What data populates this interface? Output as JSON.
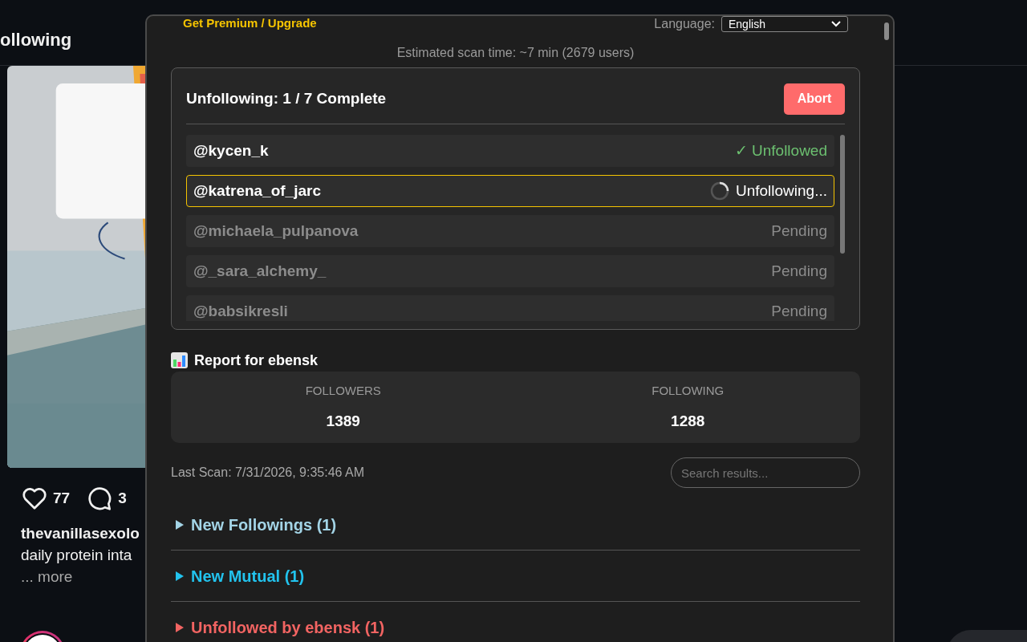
{
  "feed": {
    "header": "ollowing",
    "likes": "77",
    "comments": "3",
    "author": "thevanillasexolo",
    "caption": "daily protein inta",
    "more": "... more"
  },
  "panel": {
    "premium_link": "Get Premium / Upgrade",
    "language_label": "Language:",
    "language": "English",
    "estimate": "Estimated scan time: ~7 min (2679 users)",
    "progress": {
      "title": "Unfollowing: 1 / 7 Complete",
      "abort": "Abort",
      "rows": [
        {
          "user": "@kycen_k",
          "kind": "done",
          "label": "✓ Unfollowed"
        },
        {
          "user": "@katrena_of_jarc",
          "kind": "active",
          "label": "Unfollowing..."
        },
        {
          "user": "@michaela_pulpanova",
          "kind": "pending",
          "label": "Pending"
        },
        {
          "user": "@_sara_alchemy_",
          "kind": "pending",
          "label": "Pending"
        },
        {
          "user": "@babsikresli",
          "kind": "pending",
          "label": "Pending"
        }
      ]
    },
    "report": {
      "title": "Report for ebensk",
      "stats": [
        {
          "label": "FOLLOWERS",
          "value": "1389"
        },
        {
          "label": "FOLLOWING",
          "value": "1288"
        }
      ]
    },
    "last_scan": "Last Scan: 7/31/2026, 9:35:46 AM",
    "search": {
      "placeholder": "Search results..."
    },
    "sections": [
      {
        "title": "New Followings (1)",
        "color": "#a3d4e6",
        "expanded": false
      },
      {
        "title": "New Mutual (1)",
        "color": "#22c3ee",
        "expanded": false
      },
      {
        "title": "Unfollowed by ebensk (1)",
        "color": "#f26462",
        "expanded": false
      }
    ]
  }
}
